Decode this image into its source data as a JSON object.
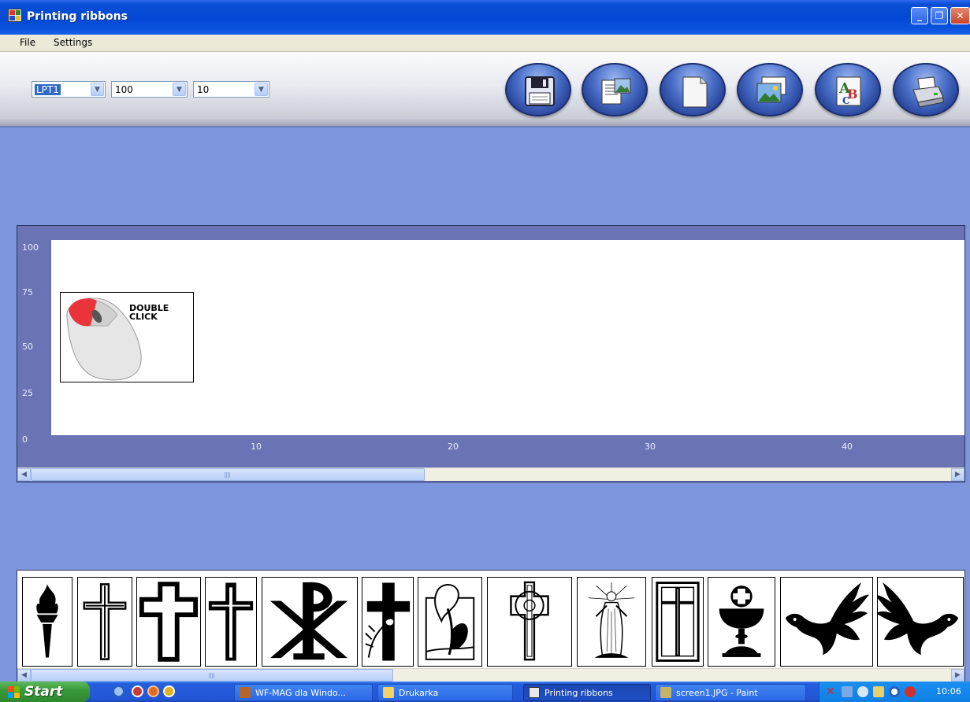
{
  "window": {
    "title": "Printing ribbons"
  },
  "menu": {
    "file": "File",
    "settings": "Settings"
  },
  "toolbar": {
    "port": "LPT1",
    "height_value": "100",
    "width_value": "10",
    "buttons": [
      "save-icon",
      "document-picture-icon",
      "new-page-icon",
      "image-icon",
      "text-abc-icon",
      "printer-icon"
    ]
  },
  "ruler": {
    "y_labels": [
      "100",
      "75",
      "50",
      "25",
      "0"
    ],
    "x_labels": [
      "10",
      "20",
      "30",
      "40"
    ]
  },
  "canvas": {
    "mouse_text_line1": "DOUBLE",
    "mouse_text_line2": "CLICK"
  },
  "symbols": [
    "torch-icon",
    "thin-cross-icon",
    "outline-cross-icon",
    "double-cross-icon",
    "chi-rho-icon",
    "cross-with-lilies-icon",
    "calla-lily-icon",
    "celtic-cross-icon",
    "jesus-figure-icon",
    "framed-cross-icon",
    "chalice-icon",
    "dove-left-icon",
    "dove-right-icon"
  ],
  "taskbar": {
    "start": "Start",
    "tasks": [
      {
        "label": "WF-MAG dla Windo...",
        "icon": "package-icon"
      },
      {
        "label": "Drukarka",
        "icon": "folder-icon"
      },
      {
        "label": "Printing ribbons",
        "icon": "app-icon"
      },
      {
        "label": "screen1.JPG - Paint",
        "icon": "paint-icon"
      }
    ],
    "clock": "10:06"
  },
  "colors": {
    "titlebar": "#0348d4",
    "workspace": "#7d95dc",
    "ruler": "#6a74b4",
    "taskbar": "#245edc",
    "start": "#3a9a3a"
  }
}
